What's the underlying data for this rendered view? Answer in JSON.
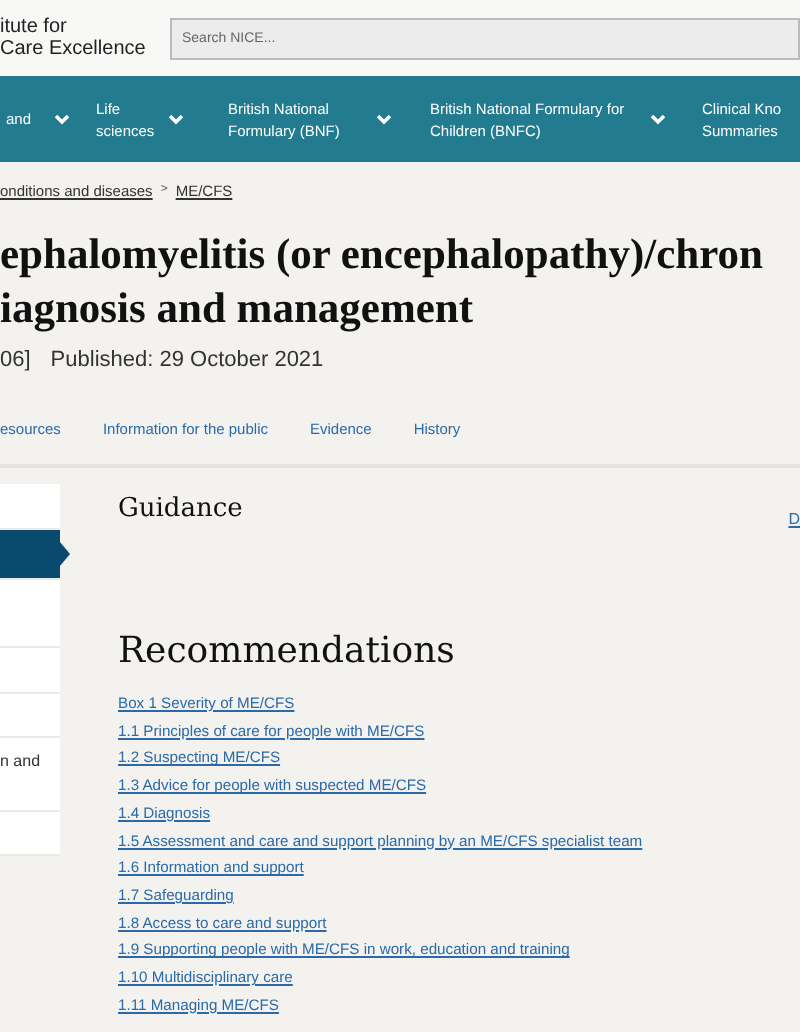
{
  "header": {
    "logo_lines": [
      "itute for",
      "Care Excellence"
    ],
    "search": {
      "placeholder": "Search NICE..."
    }
  },
  "nav": [
    {
      "label": "and",
      "has_menu": true
    },
    {
      "label": "Life sciences",
      "has_menu": true
    },
    {
      "label": "British National Formulary (BNF)",
      "has_menu": true
    },
    {
      "label": "British National Formulary for Children (BNFC)",
      "has_menu": true
    },
    {
      "label": "Clinical Kno Summaries",
      "has_menu": false
    }
  ],
  "breadcrumb": [
    "onditions and diseases",
    "ME/CFS"
  ],
  "breadcrumb_separator": ">",
  "title_lines": [
    "ephalomyelitis (or encephalopathy)/chron",
    "iagnosis and management"
  ],
  "meta": {
    "reference": "06]",
    "published": "Published: 29 October 2021"
  },
  "tabs": [
    {
      "label": "esources",
      "selected": false
    },
    {
      "label": "Information for the public",
      "selected": false
    },
    {
      "label": "Evidence",
      "selected": false
    },
    {
      "label": "History",
      "selected": false
    }
  ],
  "sidebar": {
    "items": [
      {
        "selected": false
      },
      {
        "selected": true
      },
      {
        "selected": false
      },
      {
        "selected": false
      },
      {
        "selected": false
      },
      {
        "selected": false,
        "label": "n and"
      },
      {
        "selected": false
      }
    ]
  },
  "content": {
    "heading": "Guidance",
    "side_link": "D",
    "section_title": "Recommendations",
    "links": [
      "Box 1 Severity of ME/CFS",
      "1.1 Principles of care for people with ME/CFS",
      "1.2 Suspecting ME/CFS",
      "1.3 Advice for people with suspected ME/CFS",
      "1.4 Diagnosis",
      "1.5 Assessment and care and support planning by an ME/CFS specialist team",
      "1.6 Information and support",
      "1.7 Safeguarding",
      "1.8 Access to care and support",
      "1.9 Supporting people with ME/CFS in work, education and training",
      "1.10 Multidisciplinary care",
      "1.11 Managing ME/CFS"
    ]
  }
}
